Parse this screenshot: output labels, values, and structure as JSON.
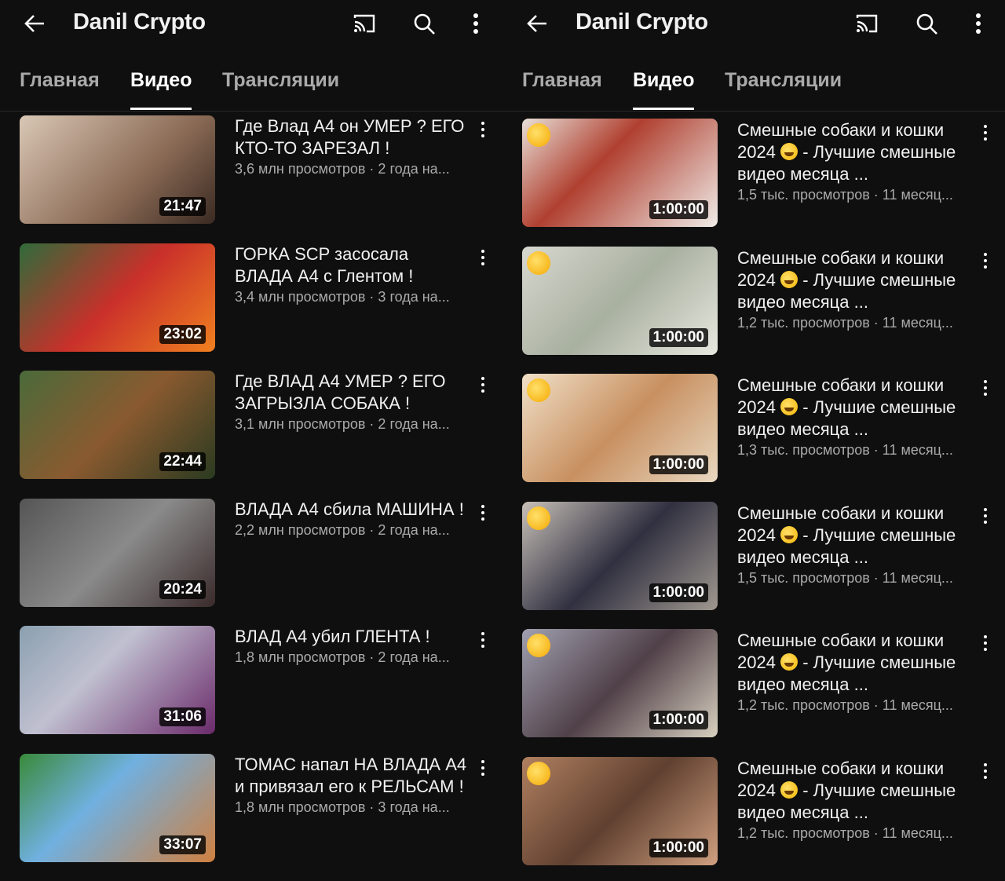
{
  "panels": [
    {
      "channel": "Danil Crypto",
      "tabs": [
        "Главная",
        "Видео",
        "Трансляции"
      ],
      "active_tab": 1,
      "videos": [
        {
          "title": "Где Влад А4 он УМЕР ? ЕГО КТО-ТО ЗАРЕЗАЛ !",
          "meta": "3,6 млн просмотров · 2 года на...",
          "duration": "21:47"
        },
        {
          "title": "ГОРКА SCP засосала ВЛАДА А4 с Глентом !",
          "meta": "3,4 млн просмотров · 3 года на...",
          "duration": "23:02"
        },
        {
          "title": "Где ВЛАД А4 УМЕР ? ЕГО ЗАГРЫЗЛА СОБАКА !",
          "meta": "3,1 млн просмотров · 2 года на...",
          "duration": "22:44"
        },
        {
          "title": "ВЛАДА А4 сбила МАШИНА !",
          "meta": "2,2 млн просмотров · 2 года на...",
          "duration": "20:24"
        },
        {
          "title": "ВЛАД А4 убил ГЛЕНТА !",
          "meta": "1,8 млн просмотров · 2 года на...",
          "duration": "31:06"
        },
        {
          "title": "ТОМАС напал НА ВЛАДА А4 и привязал его к РЕЛЬСАМ !",
          "meta": "1,8 млн просмотров · 3 года на...",
          "duration": "33:07"
        }
      ]
    },
    {
      "channel": "Danil Crypto",
      "tabs": [
        "Главная",
        "Видео",
        "Трансляции"
      ],
      "active_tab": 1,
      "videos": [
        {
          "title_a": "Смешные собаки и кошки 2024",
          "title_b": "- Лучшие смешные видео месяца ...",
          "meta": "1,5 тыс. просмотров · 11 месяц...",
          "duration": "1:00:00"
        },
        {
          "title_a": "Смешные собаки и кошки 2024",
          "title_b": "- Лучшие смешные видео месяца ...",
          "meta": "1,2 тыс. просмотров · 11 месяц...",
          "duration": "1:00:00"
        },
        {
          "title_a": "Смешные собаки и кошки 2024",
          "title_b": "- Лучшие смешные видео месяца ...",
          "meta": "1,3 тыс. просмотров · 11 месяц...",
          "duration": "1:00:00"
        },
        {
          "title_a": "Смешные собаки и кошки 2024",
          "title_b": "- Лучшие смешные видео месяца ...",
          "meta": "1,5 тыс. просмотров · 11 месяц...",
          "duration": "1:00:00"
        },
        {
          "title_a": "Смешные собаки и кошки 2024",
          "title_b": "- Лучшие смешные видео месяца ...",
          "meta": "1,2 тыс. просмотров · 11 месяц...",
          "duration": "1:00:00"
        },
        {
          "title_a": "Смешные собаки и кошки 2024",
          "title_b": "- Лучшие смешные видео месяца ...",
          "meta": "1,2 тыс. просмотров · 11 месяц...",
          "duration": "1:00:00"
        }
      ]
    }
  ]
}
